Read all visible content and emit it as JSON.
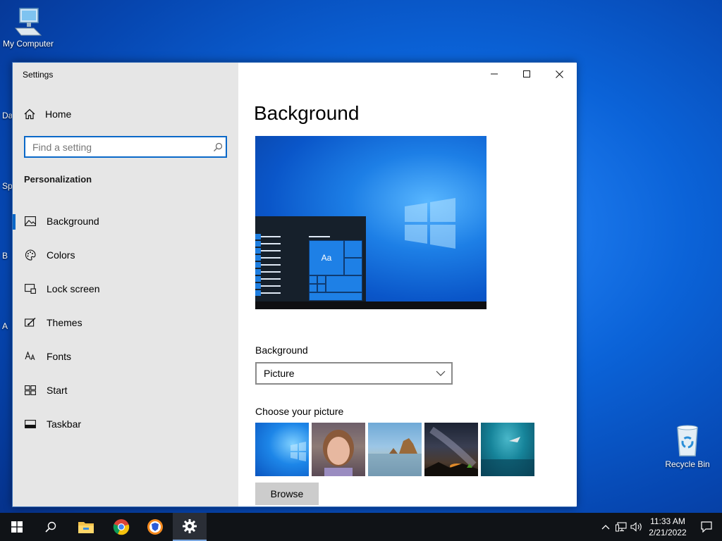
{
  "desktop": {
    "my_computer_label": "My Computer",
    "recycle_bin_label": "Recycle Bin",
    "edge_labels": [
      "Da",
      "Sp",
      "B",
      "A"
    ]
  },
  "window": {
    "title": "Settings",
    "captions": {
      "minimize_icon": "minimize-icon",
      "maximize_icon": "maximize-icon",
      "close_icon": "close-icon"
    }
  },
  "sidebar": {
    "home_label": "Home",
    "search_placeholder": "Find a setting",
    "section_title": "Personalization",
    "items": [
      {
        "label": "Background",
        "icon": "picture-icon",
        "active": true
      },
      {
        "label": "Colors",
        "icon": "palette-icon",
        "active": false
      },
      {
        "label": "Lock screen",
        "icon": "lock-screen-icon",
        "active": false
      },
      {
        "label": "Themes",
        "icon": "themes-icon",
        "active": false
      },
      {
        "label": "Fonts",
        "icon": "fonts-icon",
        "active": false
      },
      {
        "label": "Start",
        "icon": "start-icon",
        "active": false
      },
      {
        "label": "Taskbar",
        "icon": "taskbar-icon",
        "active": false
      }
    ]
  },
  "content": {
    "title": "Background",
    "preview_sample_text": "Aa",
    "background_label": "Background",
    "background_value": "Picture",
    "choose_picture_label": "Choose your picture",
    "browse_label": "Browse"
  },
  "taskbar": {
    "apps": [
      "start-icon",
      "search-icon",
      "file-explorer-icon",
      "chrome-icon",
      "brave-browser-icon",
      "settings-icon"
    ],
    "active_app": "settings-icon",
    "time": "11:33 AM",
    "date": "2/21/2022"
  },
  "colors": {
    "accent": "#0a68c8",
    "sidebar_bg": "#e6e6e6",
    "taskbar_bg": "#101317"
  }
}
